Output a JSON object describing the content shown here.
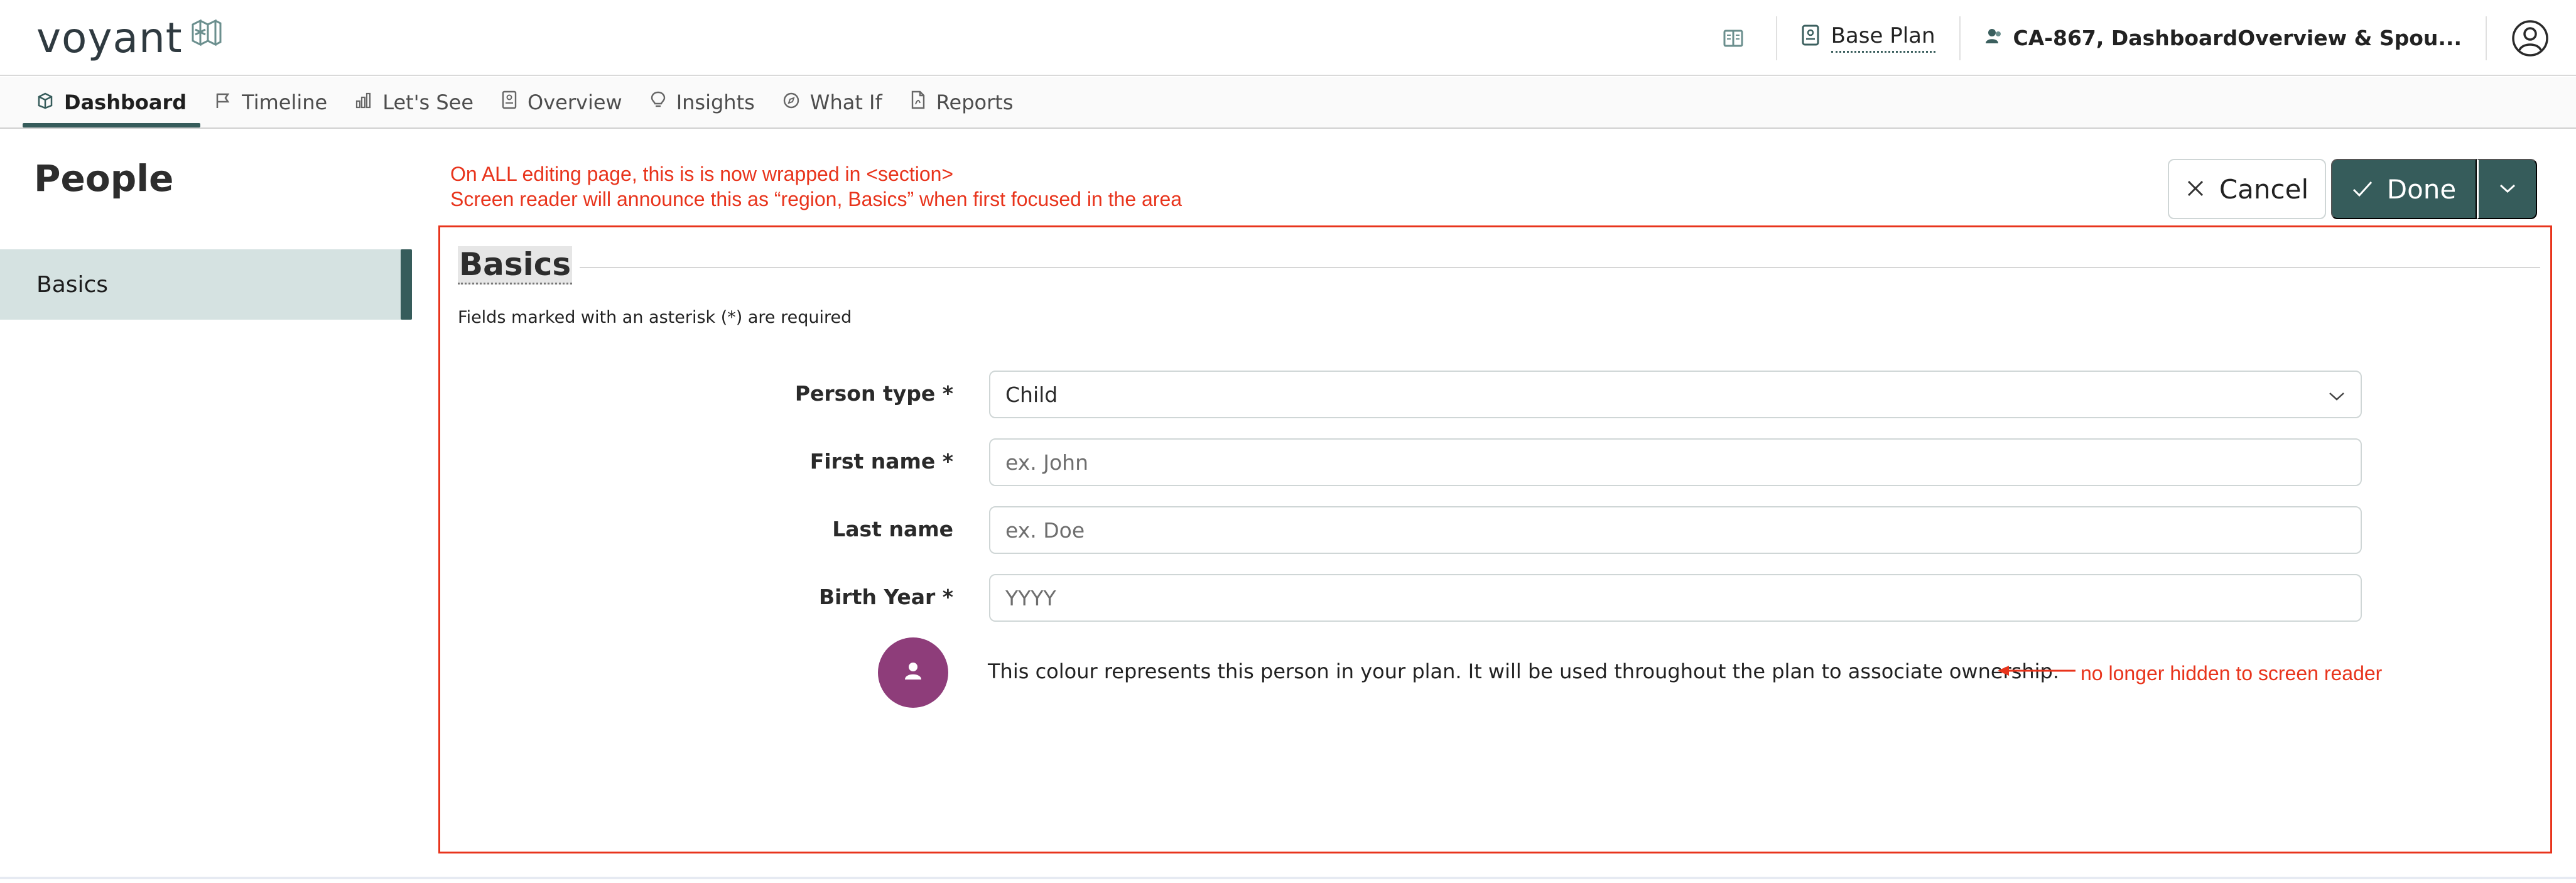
{
  "app": {
    "logo_text": "voyant",
    "base_plan_label": "Base Plan",
    "client_name": "CA-867, DashboardOverview & Spou..."
  },
  "nav": {
    "tabs": [
      {
        "label": "Dashboard",
        "icon": "dashboard-icon",
        "active": true
      },
      {
        "label": "Timeline",
        "icon": "flag-icon",
        "active": false
      },
      {
        "label": "Let's See",
        "icon": "bar-chart-icon",
        "active": false
      },
      {
        "label": "Overview",
        "icon": "document-icon",
        "active": false
      },
      {
        "label": "Insights",
        "icon": "lightbulb-icon",
        "active": false
      },
      {
        "label": "What If",
        "icon": "compass-icon",
        "active": false
      },
      {
        "label": "Reports",
        "icon": "pdf-icon",
        "active": false
      }
    ]
  },
  "page": {
    "title": "People",
    "sidebar_items": [
      {
        "label": "Basics",
        "active": true
      }
    ]
  },
  "actions": {
    "cancel_label": "Cancel",
    "done_label": "Done"
  },
  "annotations": {
    "section_line1": "On ALL editing page, this is is now wrapped in <section>",
    "section_line2": "Screen reader will announce this as “region, Basics” when first focused in the area",
    "color_note": "no longer hidden to screen reader"
  },
  "section": {
    "heading": "Basics",
    "required_note": "Fields marked with an asterisk (*) are required",
    "fields": {
      "person_type": {
        "label": "Person type *",
        "value": "Child"
      },
      "first_name": {
        "label": "First name *",
        "value": "",
        "placeholder": "ex. John"
      },
      "last_name": {
        "label": "Last name",
        "value": "",
        "placeholder": "ex. Doe"
      },
      "birth_year": {
        "label": "Birth Year *",
        "value": "",
        "placeholder": "YYYY"
      }
    },
    "color_description": "This colour represents this person in your plan. It will be used throughout the plan to associate ownership."
  },
  "colors": {
    "brand_teal": "#365c5b",
    "sidebar_active_bg": "#d5e2e1",
    "person_color": "#8e3d7a",
    "annotation_red": "#e8341c"
  }
}
